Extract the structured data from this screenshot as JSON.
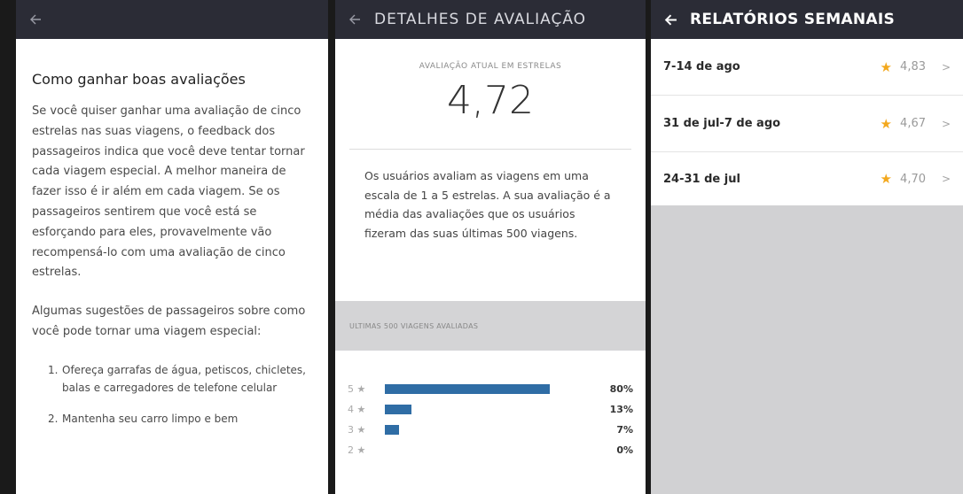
{
  "screen1": {
    "back_icon": "arrow-left-icon",
    "title": "Como ganhar boas avaliações",
    "paragraph1": "Se você quiser ganhar uma avaliação de cinco estrelas nas suas viagens, o feedback dos passageiros indica que você deve tentar tornar cada viagem especial. A melhor maneira de fazer isso é ir além em cada viagem. Se os passageiros sentirem que você está se esforçando para eles, provavelmente vão recompensá-lo com uma avaliação de cinco estrelas.",
    "paragraph2": "Algumas sugestões de passageiros sobre como você pode tornar uma viagem especial:",
    "tips": [
      {
        "num": "1.",
        "text": "Ofereça garrafas de água, petiscos, chicletes, balas e carregadores de telefone celular"
      },
      {
        "num": "2.",
        "text": "Mantenha seu carro limpo e bem"
      }
    ]
  },
  "screen2": {
    "back_icon": "arrow-left-icon",
    "title": "DETALHES DE AVALIAÇÃO",
    "rating_label": "AVALIAÇÃO ATUAL EM ESTRELAS",
    "rating_value": "4,72",
    "description": "Os usuários avaliam as viagens em uma escala de 1 a 5 estrelas. A sua avaliação é a média das avaliações que os usuários fizeram das suas últimas 500 viagens.",
    "distribution_label": "ULTIMAS 500 VIAGENS AVALIADAS",
    "bar_color": "#2f6da5",
    "distribution": [
      {
        "stars": "5 ★",
        "percent": "80%",
        "fraction": 0.8
      },
      {
        "stars": "4 ★",
        "percent": "13%",
        "fraction": 0.13
      },
      {
        "stars": "3 ★",
        "percent": "7%",
        "fraction": 0.07
      },
      {
        "stars": "2 ★",
        "percent": "0%",
        "fraction": 0.0
      }
    ]
  },
  "screen3": {
    "back_icon": "arrow-left-icon",
    "title": "RELATÓRIOS SEMANAIS",
    "star_color": "#f3a81d",
    "reports": [
      {
        "week": "7-14 de ago",
        "score": "4,83"
      },
      {
        "week": "31 de jul-7 de ago",
        "score": "4,67"
      },
      {
        "week": "24-31 de jul",
        "score": "4,70"
      }
    ]
  }
}
